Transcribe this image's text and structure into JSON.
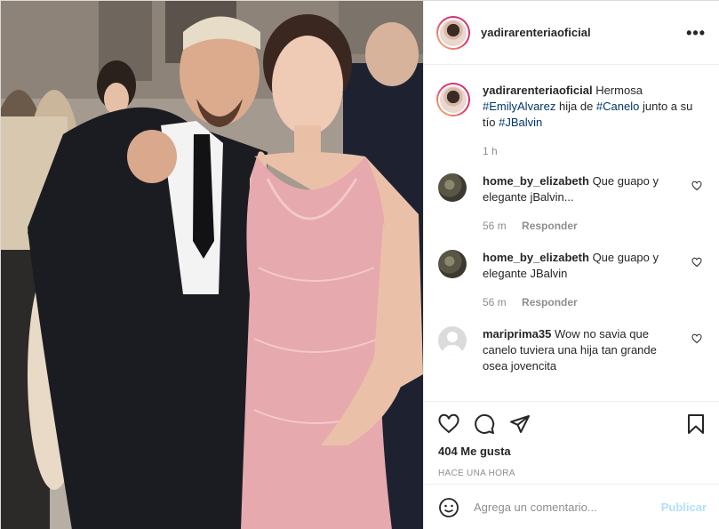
{
  "post": {
    "username": "yadirarenteriaoficial",
    "more_icon": "more-options-icon",
    "caption": {
      "username": "yadirarenteriaoficial",
      "text_1": "Hermosa",
      "tag_1": "#EmilyAlvarez",
      "text_2": "hija de",
      "tag_2": "#Canelo",
      "text_3": "junto a su tío",
      "tag_3": "#JBalvin",
      "time": "1 h"
    }
  },
  "comments": [
    {
      "username": "home_by_elizabeth",
      "text": "Que guapo y elegante jBalvin...",
      "time": "56 m",
      "reply": "Responder"
    },
    {
      "username": "home_by_elizabeth",
      "text": "Que guapo y elegante JBalvin",
      "time": "56 m",
      "reply": "Responder"
    },
    {
      "username": "mariprima35",
      "text": "Wow no savia que canelo tuviera una hija tan grande osea jovencita",
      "time": "",
      "reply": ""
    }
  ],
  "actions": {
    "likes": "404 Me gusta",
    "timestamp": "HACE UNA HORA"
  },
  "add_comment": {
    "placeholder": "Agrega un comentario...",
    "publish": "Publicar"
  },
  "colors": {
    "link": "#00376b",
    "muted": "#8e8e8e",
    "publish_disabled": "#b2dffc",
    "dress": "#e6a9ad"
  }
}
